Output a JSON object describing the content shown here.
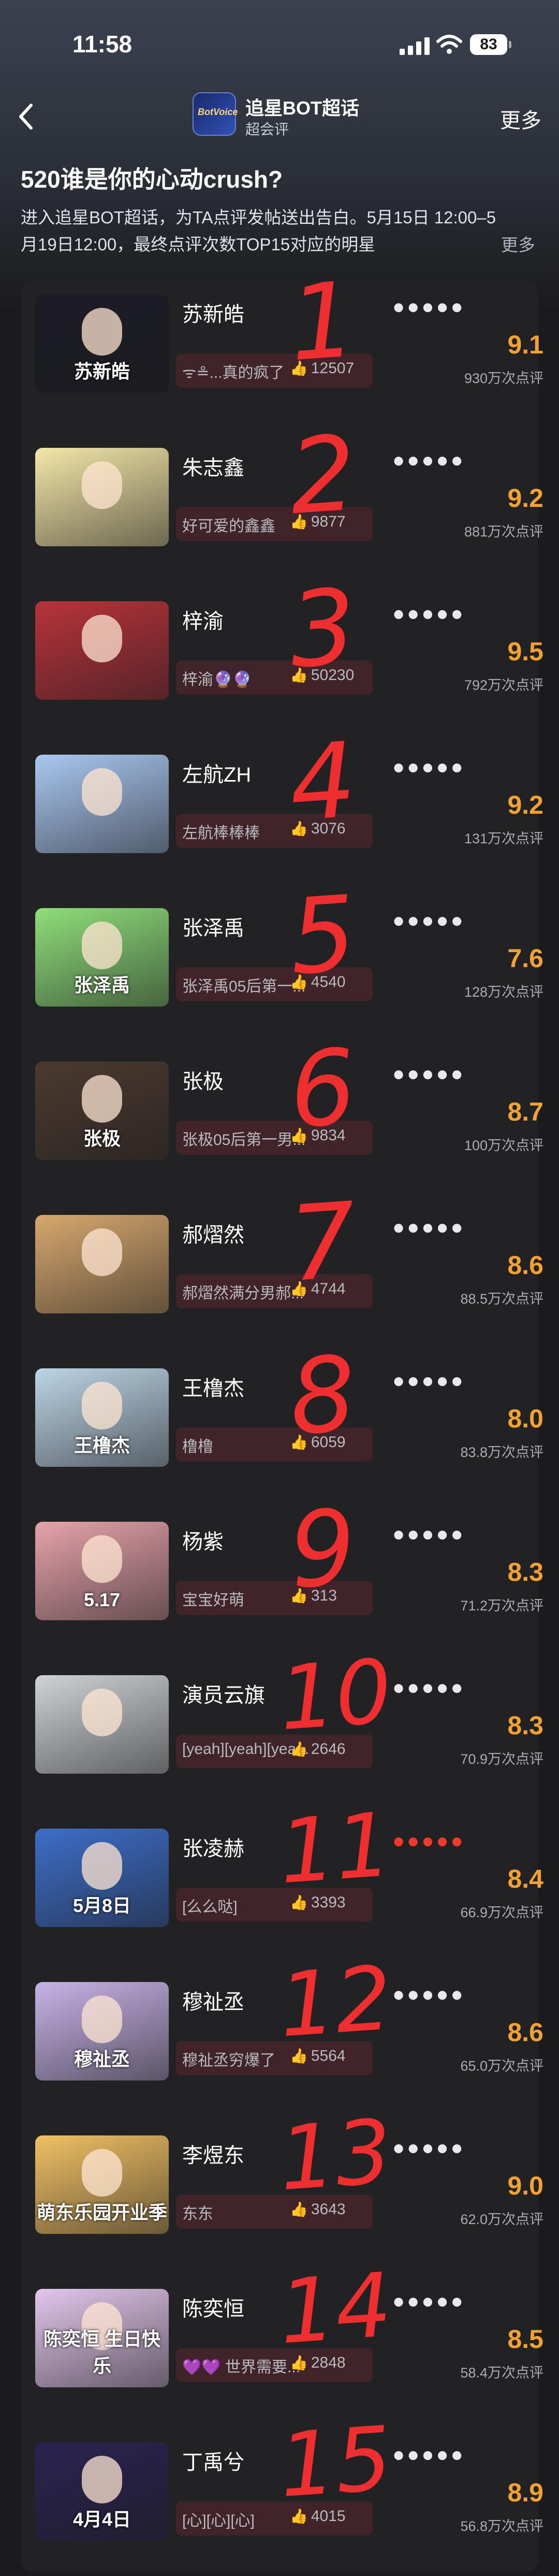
{
  "status_bar": {
    "time": "11:58",
    "battery": "83"
  },
  "header": {
    "title": "追星BOT超话",
    "subtitle": "超会评",
    "more_label": "更多",
    "logo_text": "BotVoice"
  },
  "intro": {
    "title": "520谁是你的心动crush?",
    "description": "进入追星BOT超话，为TA点评发帖送出告白。5月15日 12:00–5月19日12:00，最终点评次数TOP15对应的明星",
    "more": "更多"
  },
  "colors": {
    "accent_score": "#f2a233",
    "handwriting": "#ef2f2f"
  },
  "items": [
    {
      "rank": "1",
      "name": "苏新皓",
      "comment": "ᯤ≗...真的疯了",
      "likes": "12507",
      "score": "9.1",
      "count": "930万次点评",
      "apples": "white",
      "thumb_text": "苏新皓",
      "bg": "#1d1c26"
    },
    {
      "rank": "2",
      "name": "朱志鑫",
      "comment": "好可爱的鑫鑫",
      "likes": "9877",
      "score": "9.2",
      "count": "881万次点评",
      "apples": "white",
      "thumb_text": "",
      "bg": "#f4e7a8"
    },
    {
      "rank": "3",
      "name": "梓渝",
      "comment": "梓渝🔮🔮",
      "likes": "50230",
      "score": "9.5",
      "count": "792万次点评",
      "apples": "white",
      "thumb_text": "",
      "bg": "#b8333a"
    },
    {
      "rank": "4",
      "name": "左航ZH",
      "comment": "左航棒棒棒",
      "likes": "3076",
      "score": "9.2",
      "count": "131万次点评",
      "apples": "white",
      "thumb_text": "",
      "bg": "#a9c8f0"
    },
    {
      "rank": "5",
      "name": "张泽禹",
      "comment": "张泽禹05后第一...",
      "likes": "4540",
      "score": "7.6",
      "count": "128万次点评",
      "apples": "white",
      "thumb_text": "张泽禹",
      "bg": "#8fde7a"
    },
    {
      "rank": "6",
      "name": "张极",
      "comment": "张极05后第一男...",
      "likes": "9834",
      "score": "8.7",
      "count": "100万次点评",
      "apples": "white",
      "thumb_text": "张极",
      "bg": "#4b3a2f"
    },
    {
      "rank": "7",
      "name": "郝熠然",
      "comment": "郝熠然满分男郝...",
      "likes": "4744",
      "score": "8.6",
      "count": "88.5万次点评",
      "apples": "white",
      "thumb_text": "",
      "bg": "#d7a86e"
    },
    {
      "rank": "8",
      "name": "王橹杰",
      "comment": "橹橹",
      "likes": "6059",
      "score": "8.0",
      "count": "83.8万次点评",
      "apples": "white",
      "thumb_text": "王橹杰",
      "bg": "#bcd5e6"
    },
    {
      "rank": "9",
      "name": "杨紫",
      "comment": "宝宝好萌",
      "likes": "313",
      "score": "8.3",
      "count": "71.2万次点评",
      "apples": "white",
      "thumb_text": "5.17",
      "bg": "#e6a3aa"
    },
    {
      "rank": "10",
      "name": "演员云旗",
      "comment": "[yeah][yeah][yea...",
      "likes": "2646",
      "score": "8.3",
      "count": "70.9万次点评",
      "apples": "white",
      "thumb_text": "",
      "bg": "#cfd3d6"
    },
    {
      "rank": "11",
      "name": "张凌赫",
      "comment": "[么么哒]",
      "likes": "3393",
      "score": "8.4",
      "count": "66.9万次点评",
      "apples": "red",
      "thumb_text": "5月8日",
      "bg": "#3d6ec9"
    },
    {
      "rank": "12",
      "name": "穆祉丞",
      "comment": "穆祉丞穷爆了",
      "likes": "5564",
      "score": "8.6",
      "count": "65.0万次点评",
      "apples": "white",
      "thumb_text": "穆祉丞",
      "bg": "#c7b3e6"
    },
    {
      "rank": "13",
      "name": "李煜东",
      "comment": "东东",
      "likes": "3643",
      "score": "9.0",
      "count": "62.0万次点评",
      "apples": "white",
      "thumb_text": "萌东乐园开业季",
      "bg": "#f0c064"
    },
    {
      "rank": "14",
      "name": "陈奕恒",
      "comment": "💜💜 世界需要...",
      "likes": "2848",
      "score": "8.5",
      "count": "58.4万次点评",
      "apples": "white",
      "thumb_text": "陈奕恒 生日快乐",
      "bg": "#e3c6ec"
    },
    {
      "rank": "15",
      "name": "丁禹兮",
      "comment": "[心][心][心]",
      "likes": "4015",
      "score": "8.9",
      "count": "56.8万次点评",
      "apples": "white",
      "thumb_text": "4月4日",
      "bg": "#2a2350"
    }
  ]
}
